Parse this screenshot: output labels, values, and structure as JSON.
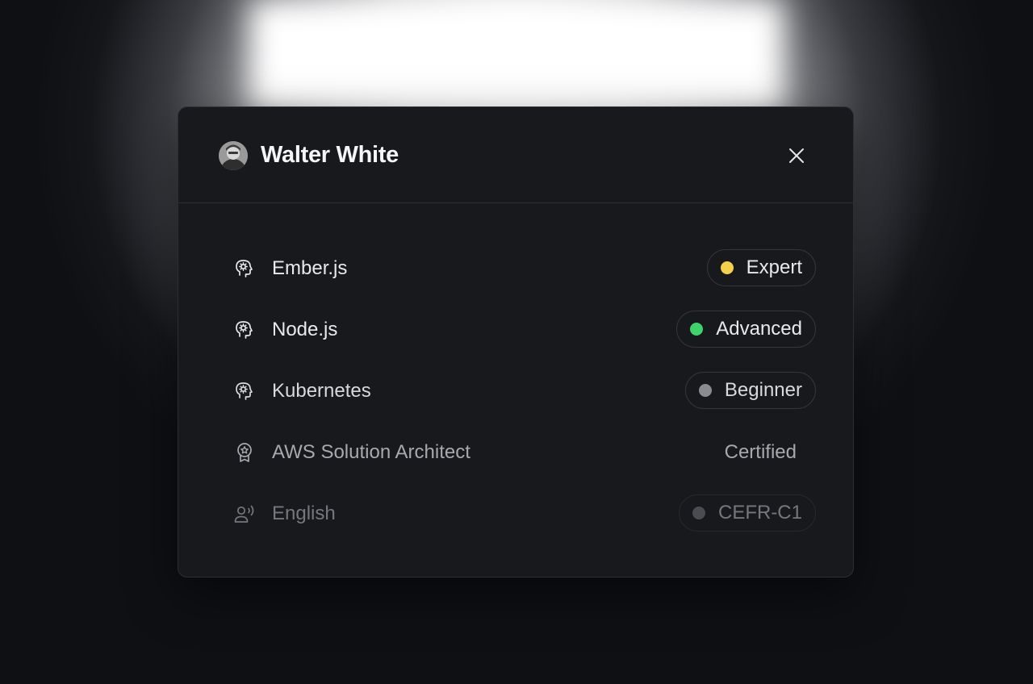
{
  "dialog": {
    "title": "Walter White",
    "close_icon": "close-icon",
    "avatar_icon": "user-avatar"
  },
  "skills": [
    {
      "label": "Ember.js",
      "icon": "brain-gear-icon",
      "level": "Expert",
      "dot_color": "#f5d04a",
      "text_color": "#e9e9eb",
      "badge_style": "pill"
    },
    {
      "label": "Node.js",
      "icon": "brain-gear-icon",
      "level": "Advanced",
      "dot_color": "#3ed36b",
      "text_color": "#e9e9eb",
      "badge_style": "pill"
    },
    {
      "label": "Kubernetes",
      "icon": "brain-gear-icon",
      "level": "Beginner",
      "dot_color": "#8a8b90",
      "text_color": "#d9d9dc",
      "badge_style": "pill"
    },
    {
      "label": "AWS Solution Architect",
      "icon": "award-ribbon-icon",
      "level": "Certified",
      "text_color": "#a8a9ae",
      "badge_style": "plain"
    },
    {
      "label": "English",
      "icon": "speaking-person-icon",
      "level": "CEFR-C1",
      "dot_color": "#4b4c51",
      "text_color": "#76777c",
      "badge_style": "pill-faded"
    }
  ]
}
